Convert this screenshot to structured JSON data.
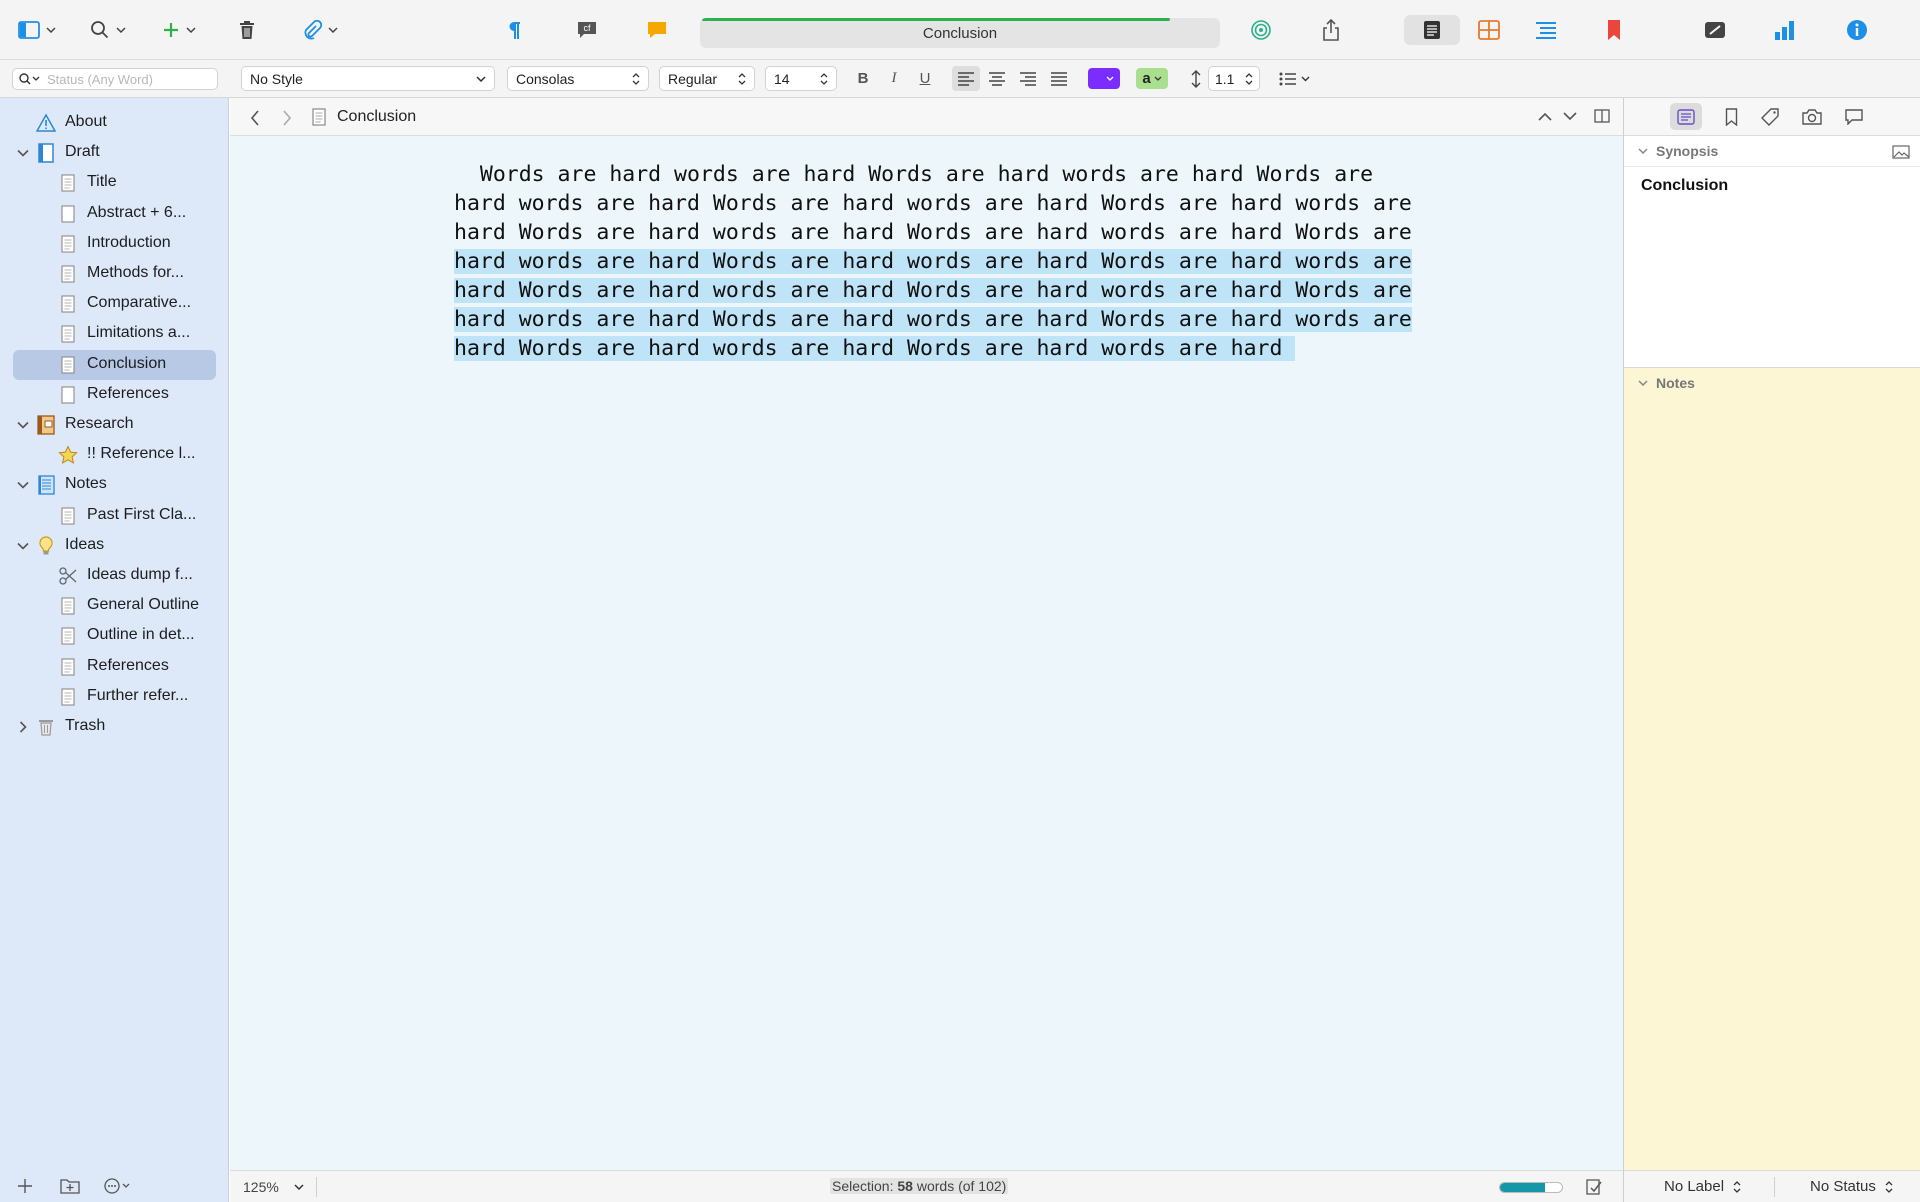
{
  "window": {
    "title": "Conclusion"
  },
  "toolbar": {
    "title": "Conclusion",
    "word_target_progress": 0.9,
    "colors": {
      "accent_blue": "#1e8fe6",
      "progress_green": "#2bb24c",
      "orange": "#e99b2d",
      "red": "#e9463c"
    }
  },
  "search": {
    "placeholder": "Status (Any Word)"
  },
  "format": {
    "style": "No Style",
    "font": "Consolas",
    "weight": "Regular",
    "size": "14",
    "bold": "B",
    "italic": "I",
    "underline": "U",
    "text_color": "#7b2cff",
    "highlight_label": "a",
    "highlight_color": "#a9e08f",
    "line_spacing": "1.1"
  },
  "binder": {
    "items": [
      {
        "label": "About",
        "icon": "warning-icon",
        "level": 0
      },
      {
        "label": "Draft",
        "icon": "draft-folder-icon",
        "level": 0,
        "disclosure": "open"
      },
      {
        "label": "Title",
        "icon": "text-document-icon",
        "level": 1
      },
      {
        "label": "Abstract + 6...",
        "icon": "blank-document-icon",
        "level": 1
      },
      {
        "label": "Introduction",
        "icon": "text-document-icon",
        "level": 1
      },
      {
        "label": "Methods for...",
        "icon": "text-document-icon",
        "level": 1
      },
      {
        "label": "Comparative...",
        "icon": "text-document-icon",
        "level": 1
      },
      {
        "label": "Limitations a...",
        "icon": "text-document-icon",
        "level": 1
      },
      {
        "label": "Conclusion",
        "icon": "text-document-icon",
        "level": 1,
        "selected": true
      },
      {
        "label": "References",
        "icon": "blank-document-icon",
        "level": 1
      },
      {
        "label": "Research",
        "icon": "research-folder-icon",
        "level": 0,
        "disclosure": "open"
      },
      {
        "label": "!! Reference l...",
        "icon": "star-icon",
        "level": 1
      },
      {
        "label": "Notes",
        "icon": "notebook-icon",
        "level": 0,
        "disclosure": "open"
      },
      {
        "label": "Past First Cla...",
        "icon": "text-document-icon",
        "level": 1
      },
      {
        "label": "Ideas",
        "icon": "lightbulb-icon",
        "level": 0,
        "disclosure": "open"
      },
      {
        "label": "Ideas dump f...",
        "icon": "scissors-icon",
        "level": 1
      },
      {
        "label": "General Outline",
        "icon": "text-document-icon",
        "level": 1
      },
      {
        "label": "Outline in det...",
        "icon": "text-document-icon",
        "level": 1
      },
      {
        "label": "References",
        "icon": "text-document-icon",
        "level": 1
      },
      {
        "label": "Further refer...",
        "icon": "text-document-icon",
        "level": 1
      },
      {
        "label": "Trash",
        "icon": "trash-icon",
        "level": 0,
        "disclosure": "closed"
      }
    ]
  },
  "editor": {
    "header_title": "Conclusion",
    "lines": [
      {
        "text": "  Words are hard words are hard Words are hard words are hard Words are",
        "selected": false
      },
      {
        "text": "hard words are hard Words are hard words are hard Words are hard words are",
        "selected": false
      },
      {
        "text": "hard Words are hard words are hard Words are hard words are hard Words are",
        "selected": false
      },
      {
        "text": "hard words are hard Words are hard words are hard Words are hard words are",
        "selected": true
      },
      {
        "text": "hard Words are hard words are hard Words are hard words are hard Words are",
        "selected": true
      },
      {
        "text": "hard words are hard Words are hard words are hard Words are hard words are",
        "selected": true
      },
      {
        "text": "hard Words are hard words are hard Words are hard words are hard ",
        "selected": true
      }
    ]
  },
  "statusbar": {
    "zoom": "125%",
    "selection_prefix": "Selection: ",
    "selection_count": "58",
    "selection_suffix": " words (of 102)",
    "target_progress": 0.72
  },
  "inspector": {
    "synopsis_heading": "Synopsis",
    "synopsis_title": "Conclusion",
    "notes_heading": "Notes",
    "label_value": "No Label",
    "status_value": "No Status"
  }
}
